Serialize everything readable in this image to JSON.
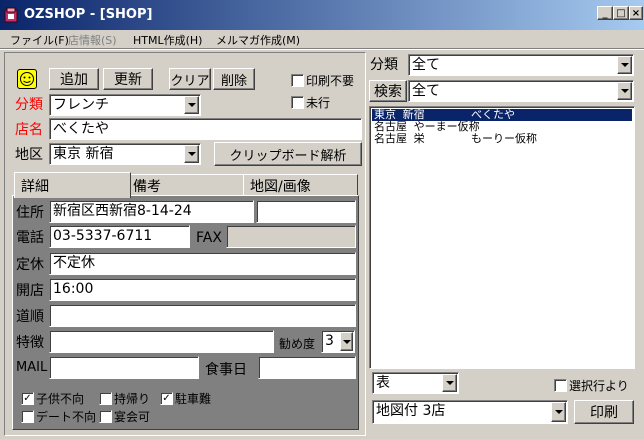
{
  "window": {
    "title": "OZSHOP - [SHOP]",
    "controls": {
      "minimize": "_",
      "maximize": "□",
      "close": "×"
    }
  },
  "menu": {
    "items": [
      {
        "label": "ファイル(F)",
        "enabled": true
      },
      {
        "label": "店情報(S)",
        "enabled": false
      },
      {
        "label": "HTML作成(H)",
        "enabled": true
      },
      {
        "label": "メルマガ作成(M)",
        "enabled": true
      }
    ]
  },
  "toolbar": {
    "add": "追加",
    "update": "更新",
    "clear": "クリア",
    "delete": "削除",
    "no_print": "印刷不要",
    "not_visited": "未行",
    "no_print_checked": false,
    "not_visited_checked": false
  },
  "form": {
    "category_label": "分類",
    "category_value": "フレンチ",
    "name_label": "店名",
    "name_value": "べくたや",
    "area_label": "地区",
    "area_value": "東京 新宿",
    "clipboard_button": "クリップボード解析"
  },
  "tabs": [
    {
      "label": "詳細"
    },
    {
      "label": "備考"
    },
    {
      "label": "地図/画像"
    }
  ],
  "detail": {
    "address_label": "住所",
    "address_value": "新宿区西新宿8-14-24",
    "address_value2": "",
    "phone_label": "電話",
    "phone_value": "03-5337-6711",
    "fax_label": "FAX",
    "fax_value": "",
    "holiday_label": "定休",
    "holiday_value": "不定休",
    "open_label": "開店",
    "open_value": "16:00",
    "route_label": "道順",
    "route_value": "",
    "feature_label": "特徴",
    "feature_value": "",
    "recommend_label": "勧め度",
    "recommend_value": "3",
    "mail_label": "MAIL",
    "mail_value": "",
    "meal_day_label": "食事日",
    "meal_day_value": "",
    "checks": [
      {
        "label": "子供不向",
        "checked": true
      },
      {
        "label": "持帰り",
        "checked": false
      },
      {
        "label": "駐車難",
        "checked": true
      },
      {
        "label": "デート不向",
        "checked": false
      },
      {
        "label": "宴会可",
        "checked": false
      }
    ]
  },
  "right": {
    "category_label": "分類",
    "category_value": "全て",
    "search_label": "検索",
    "search_value": "全て",
    "list": [
      {
        "text": "東京 新宿       べくたや",
        "selected": true
      },
      {
        "text": "名古屋 やーまー仮称",
        "selected": false
      },
      {
        "text": "名古屋 栄       もーりー仮称",
        "selected": false
      }
    ],
    "view_value": "表",
    "selected_rows_label": "選択行より",
    "selected_rows_checked": false,
    "print_format_value": "地図付 3店",
    "print_button": "印刷"
  },
  "colors": {
    "title_start": "#0a246a",
    "title_end": "#a6caf0",
    "red_label": "#ff0000",
    "selection": "#0a246a",
    "tab_panel": "#808080"
  }
}
